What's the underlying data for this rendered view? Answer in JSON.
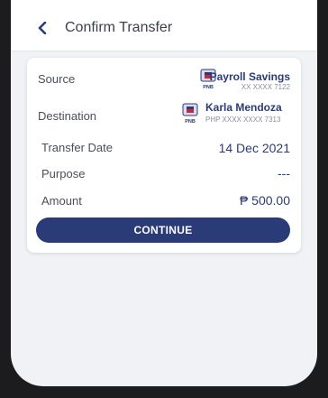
{
  "header": {
    "title": "Confirm Transfer"
  },
  "source": {
    "label": "Source",
    "bank_logo_text": "PNB",
    "account_name": "Payroll Savings",
    "account_number": "XX XXXX 7122"
  },
  "destination": {
    "label": "Destination",
    "bank_logo_text": "PNB",
    "account_name": "Karla Mendoza",
    "account_number": "PHP XXXX XXXX 7313"
  },
  "transfer_date": {
    "label": "Transfer Date",
    "value": "14 Dec 2021"
  },
  "purpose": {
    "label": "Purpose",
    "value": "---"
  },
  "amount": {
    "label": "Amount",
    "value": "₱ 500.00"
  },
  "actions": {
    "continue_label": "CONTINUE"
  },
  "colors": {
    "brand": "#2a3b77",
    "background": "#f1f2f6",
    "bezel": "#1c1c1e"
  },
  "icons": {
    "back": "chevron-left-icon",
    "bank": "pnb-logo-icon"
  }
}
